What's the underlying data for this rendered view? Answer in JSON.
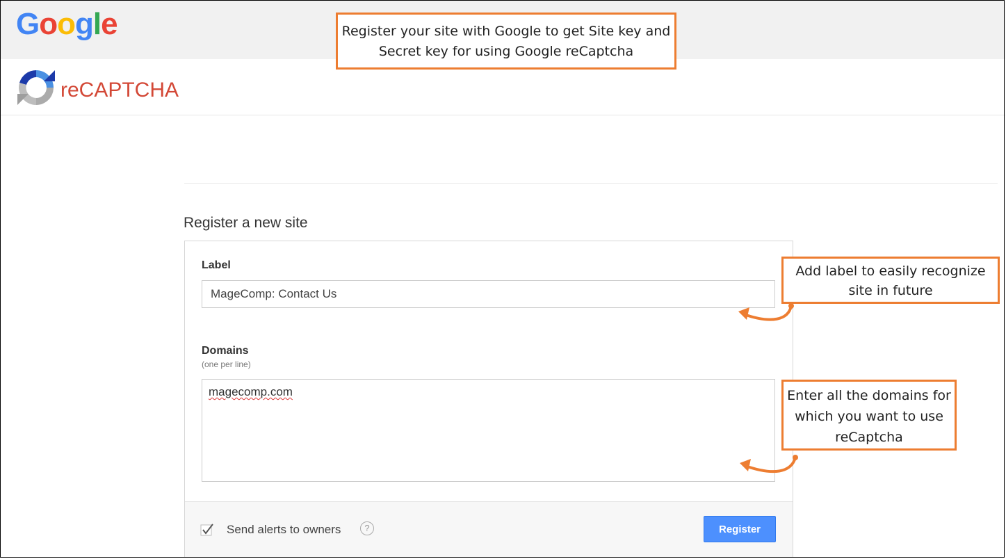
{
  "header": {
    "google_logo": [
      "G",
      "o",
      "o",
      "g",
      "l",
      "e"
    ],
    "product_name": "reCAPTCHA",
    "icons": {
      "recaptcha": "recaptcha-logo-icon"
    }
  },
  "annotations": {
    "top": "Register your site with Google to get Site key and Secret key for using Google reCaptcha",
    "label": "Add label to easily recognize site in future",
    "domains": "Enter all the domains for which you want to use reCaptcha",
    "color": "#ed7d31"
  },
  "form": {
    "title": "Register a new site",
    "label_field": {
      "label": "Label",
      "value": "MageComp: Contact Us"
    },
    "domains_field": {
      "label": "Domains",
      "hint": "(one per line)",
      "value": "magecomp.com"
    },
    "alerts": {
      "label": "Send alerts to owners",
      "checked": true,
      "help": "?"
    },
    "submit_label": "Register"
  },
  "colors": {
    "google_blue": "#4285f4",
    "google_red": "#ea4335",
    "google_yellow": "#fbbc05",
    "google_green": "#34a853",
    "recaptcha_text": "#d34836",
    "button_blue": "#4d90fe"
  }
}
